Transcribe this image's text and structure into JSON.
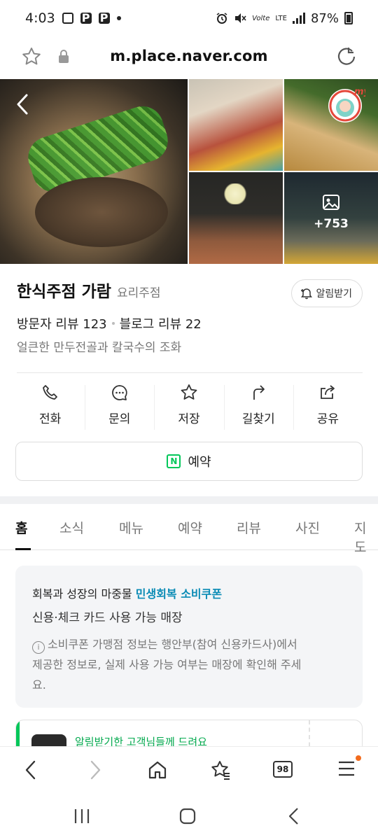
{
  "status_bar": {
    "time": "4:03",
    "network": "LTE",
    "volte": "Volte",
    "battery": "87%"
  },
  "browser": {
    "url": "m.place.naver.com",
    "tab_count": "98"
  },
  "photos": {
    "more_count": "+753",
    "badge_label": "my"
  },
  "place": {
    "name": "한식주점 가람",
    "category": "요리주점",
    "alert_button": "알림받기",
    "visitor_reviews": "방문자 리뷰 123",
    "blog_reviews": "블로그 리뷰 22",
    "description": "얼큰한 만두전골과 칼국수의 조화"
  },
  "actions": [
    {
      "label": "전화",
      "icon": "phone-icon"
    },
    {
      "label": "문의",
      "icon": "chat-icon"
    },
    {
      "label": "저장",
      "icon": "star-icon"
    },
    {
      "label": "길찾기",
      "icon": "directions-icon"
    },
    {
      "label": "공유",
      "icon": "share-icon"
    }
  ],
  "reserve": {
    "label": "예약",
    "badge": "N"
  },
  "tabs": [
    {
      "label": "홈",
      "active": true
    },
    {
      "label": "소식"
    },
    {
      "label": "메뉴"
    },
    {
      "label": "예약"
    },
    {
      "label": "리뷰"
    },
    {
      "label": "사진"
    },
    {
      "label": "지도"
    }
  ],
  "coupon": {
    "headline_prefix": "회복과 성장의 마중물",
    "headline_highlight": "민생회복 소비쿠폰",
    "subtitle": "신용·체크 카드 사용 가능 매장",
    "info_line1": "소비쿠폰 가맹점 정보는 행안부(참여 신용카드사)에서",
    "info_line2": "제공한 정보로, 실제 사용 가능 여부는 매장에 확인해 주세",
    "info_line3": "요."
  },
  "notice": {
    "text": "알림받기한 고객님들께 드려요"
  },
  "colors": {
    "naver_green": "#03c75a",
    "coupon_highlight": "#0a8bb5",
    "notification_dot": "#f26b1d"
  }
}
